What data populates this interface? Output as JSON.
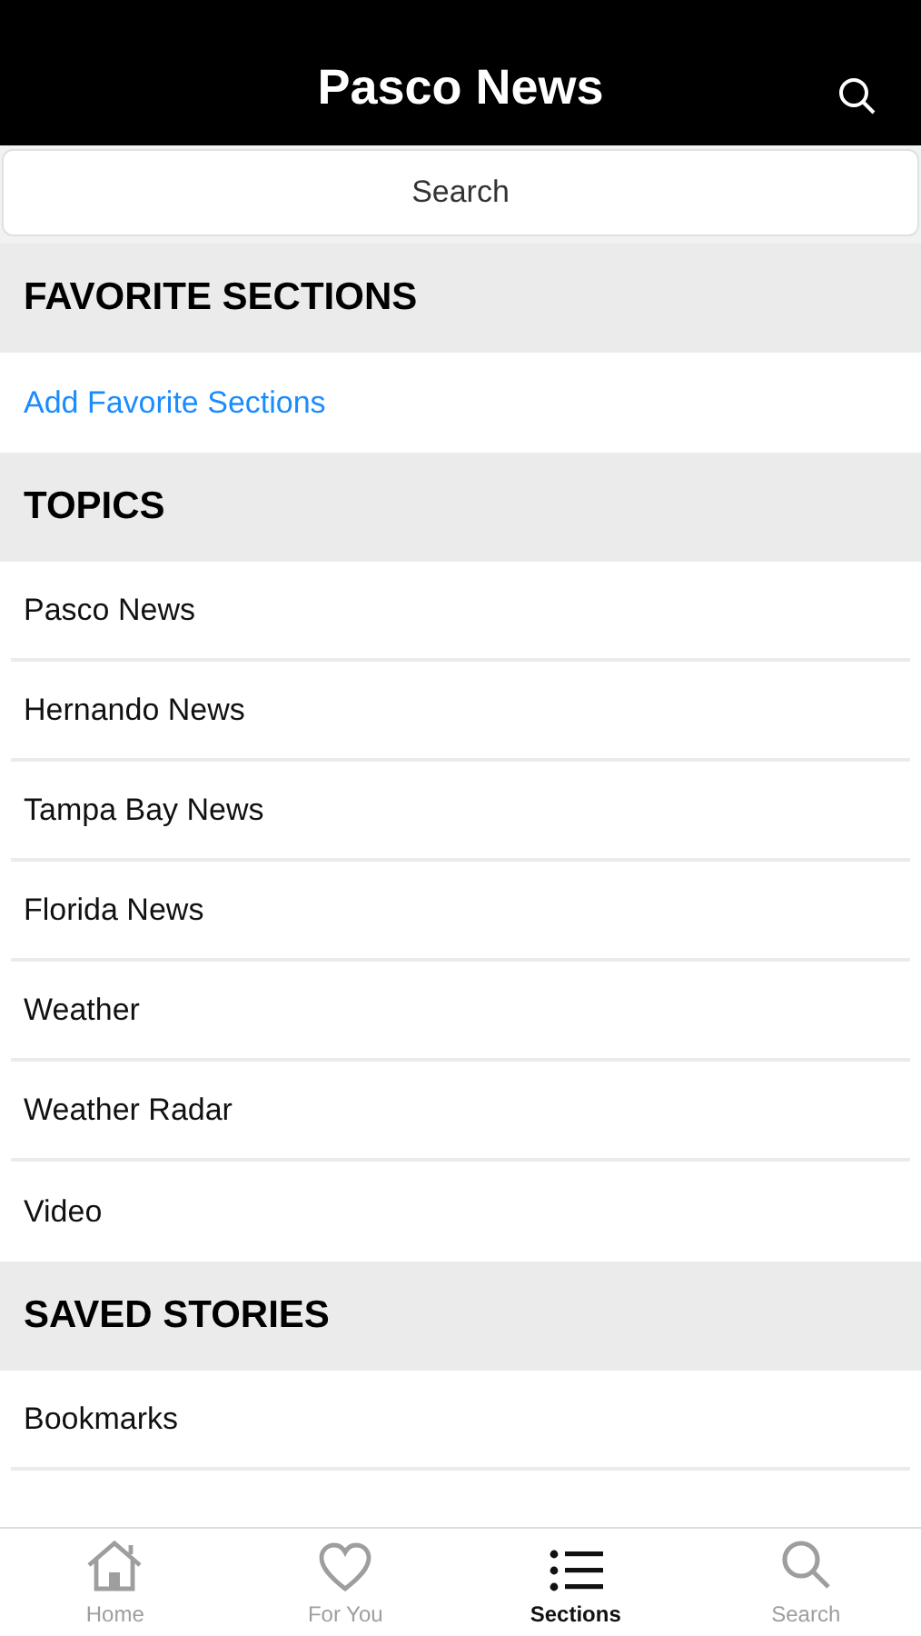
{
  "header": {
    "title": "Pasco News"
  },
  "search": {
    "placeholder": "Search"
  },
  "sections": [
    {
      "title": "FAVORITE SECTIONS",
      "items": [
        {
          "label": "Add Favorite Sections",
          "kind": "link"
        }
      ]
    },
    {
      "title": "TOPICS",
      "items": [
        {
          "label": "Pasco News",
          "kind": "row"
        },
        {
          "label": "Hernando News",
          "kind": "row"
        },
        {
          "label": "Tampa Bay News",
          "kind": "row"
        },
        {
          "label": "Florida News",
          "kind": "row"
        },
        {
          "label": "Weather",
          "kind": "row"
        },
        {
          "label": "Weather Radar",
          "kind": "row"
        },
        {
          "label": "Video",
          "kind": "row"
        }
      ]
    },
    {
      "title": "SAVED STORIES",
      "items": [
        {
          "label": "Bookmarks",
          "kind": "row"
        }
      ]
    }
  ],
  "tabs": [
    {
      "label": "Home",
      "kind": "home",
      "selected": false
    },
    {
      "label": "For You",
      "kind": "heart",
      "selected": false
    },
    {
      "label": "Sections",
      "kind": "list",
      "selected": true
    },
    {
      "label": "Search",
      "kind": "search",
      "selected": false
    }
  ]
}
